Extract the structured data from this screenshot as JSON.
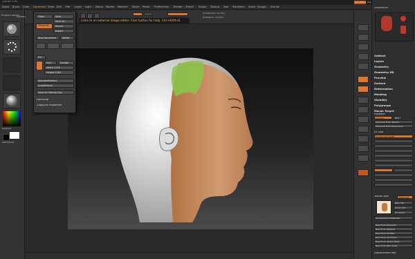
{
  "window": {
    "title": "ZBrush 4 R6"
  },
  "menus": [
    "Alpha",
    "Brush",
    "Color",
    "Document",
    "Draw",
    "Edit",
    "File",
    "Layer",
    "Light",
    "Macro",
    "Marker",
    "Material",
    "Movie",
    "Picker",
    "Preferences",
    "Render",
    "Stencil",
    "Stroke",
    "Texture",
    "Tool",
    "Transform",
    "Zoom",
    "Zplugin",
    "Zscript"
  ],
  "active_menu": "Document",
  "header_info": {
    "save_notice": "Link to an external image editor. Click button for help.",
    "quicksave": "QuickSave",
    "see_through": "See-through 0",
    "menus_btn": "Menus",
    "default_script": "DefaultZScript"
  },
  "tooltip": "Links to an external image editor. Click button for help. Ctrl+Shift+E",
  "left_shelf": {
    "projection_master": "Projection Master",
    "lightbox": "LightBox",
    "gradient": "Gradient",
    "switch_color": "SwitchColor"
  },
  "popup": {
    "open": "Open",
    "save": "Save",
    "save_as": "Save As",
    "revert": "Revert",
    "import": "Import",
    "export": "Export",
    "new_document": "New Document",
    "wsize": "WSize",
    "pro": "Pro",
    "half": "Half",
    "double": "Double",
    "width": "Width 1178",
    "height": "Height 1060",
    "standard_history": "StandardHistory",
    "undo_history": "UndoHistory",
    "save_as_startup": "Save As Startup Doc",
    "paint_stop": "PaintStop",
    "zapplink": "ZAppLink Properties"
  },
  "right_tray": {
    "tool_header": "SimpleBrush",
    "items": [
      "Subtool",
      "Layers",
      "Geometry",
      "Geometry HD",
      "Preview",
      "Surface",
      "Deformation",
      "Masking",
      "Visibility",
      "Polygroups",
      "Morph Target"
    ],
    "polypaint": "Polypaint",
    "colorize": "Colorize",
    "grd": "Grd",
    "polypaint_from_texture": "Polypaint From Texture",
    "polypaint_from_polygroups": "Polypaint From Polygroups",
    "uv_map": "UV Map",
    "uv_size": "UV Map Size 2048",
    "texture_map": "Texture Map",
    "texture_on": "Texture On",
    "new_texture": "New Txtr",
    "clone_texture": "Clone Txtr",
    "fix_seam": "Fix Seam",
    "transparent_antialiased": "Transparent Antialiased",
    "new_from_polypaint": "New From Polypaint",
    "new_from_masking": "New From Masking",
    "new_from_uv_map": "New From UV Map",
    "new_from_uv_check": "New From UV Check",
    "new_from_vertex_order": "New From Vertex Order",
    "new_from_poly_order": "New From Poly Order",
    "displacement_map": "Displacement Map"
  },
  "colors": {
    "accent": "#e0782b",
    "canvas_top": "#0f0f0f",
    "canvas_bottom": "#4b4b4b",
    "head_white": "#eeeeee",
    "skin": "#c58a5a",
    "mask_green": "#7fbf3f"
  }
}
